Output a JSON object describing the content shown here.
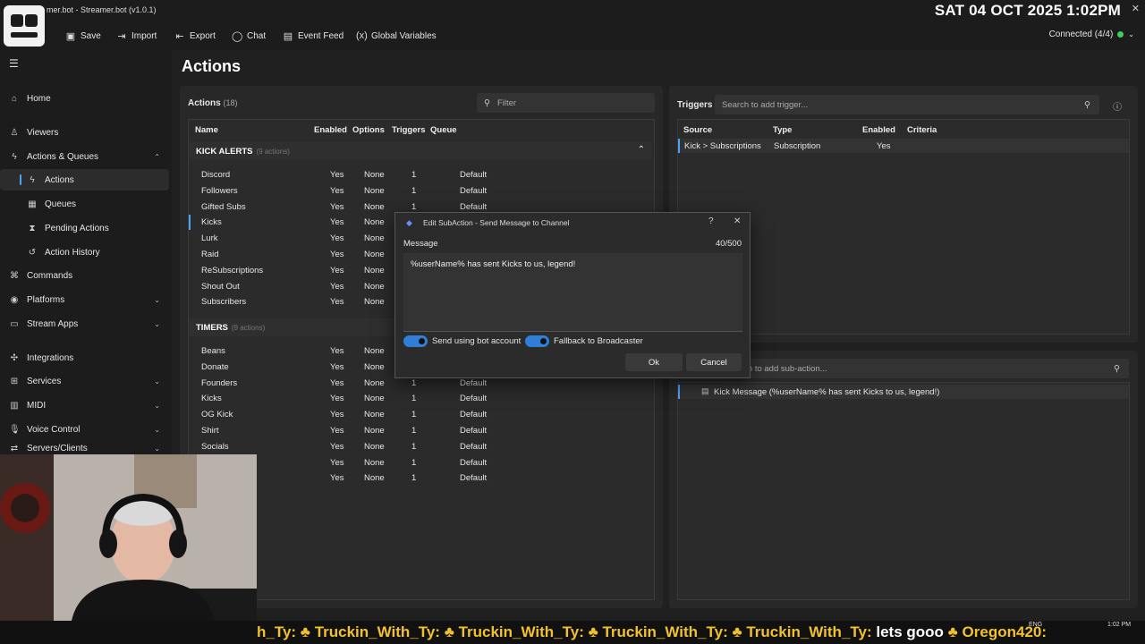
{
  "window": {
    "title": "mer.bot - Streamer.bot (v1.0.1)",
    "clock": "SAT 04 OCT 2025 1:02PM",
    "connected": "Connected (4/4)",
    "min_glyph": "—",
    "max_glyph": "☐",
    "close_glyph": "✕"
  },
  "toolbar": {
    "save": "Save",
    "import": "Import",
    "export": "Export",
    "chat": "Chat",
    "event_feed": "Event Feed",
    "global_variables": "Global Variables"
  },
  "sidebar": {
    "home": "Home",
    "viewers": "Viewers",
    "actions_queues": "Actions & Queues",
    "actions": "Actions",
    "queues": "Queues",
    "pending_actions": "Pending Actions",
    "action_history": "Action History",
    "commands": "Commands",
    "platforms": "Platforms",
    "stream_apps": "Stream Apps",
    "integrations": "Integrations",
    "services": "Services",
    "midi": "MIDI",
    "voice_control": "Voice Control",
    "servers_clients": "Servers/Clients"
  },
  "main": {
    "page_title": "Actions",
    "actions_label": "Actions",
    "actions_count": "(18)",
    "filter_placeholder": "Filter",
    "columns": [
      "Name",
      "Enabled",
      "Options",
      "Triggers",
      "Queue"
    ],
    "group1": {
      "name": "KICK ALERTS",
      "count": "(9 actions)"
    },
    "group1_rows": [
      {
        "name": "Discord",
        "enabled": "Yes",
        "options": "None",
        "triggers": "1",
        "queue": "Default"
      },
      {
        "name": "Followers",
        "enabled": "Yes",
        "options": "None",
        "triggers": "1",
        "queue": "Default"
      },
      {
        "name": "Gifted Subs",
        "enabled": "Yes",
        "options": "None",
        "triggers": "1",
        "queue": "Default"
      },
      {
        "name": "Kicks",
        "enabled": "Yes",
        "options": "None",
        "triggers": "",
        "queue": ""
      },
      {
        "name": "Lurk",
        "enabled": "Yes",
        "options": "None",
        "triggers": "",
        "queue": ""
      },
      {
        "name": "Raid",
        "enabled": "Yes",
        "options": "None",
        "triggers": "",
        "queue": ""
      },
      {
        "name": "ReSubscriptions",
        "enabled": "Yes",
        "options": "None",
        "triggers": "",
        "queue": ""
      },
      {
        "name": "Shout Out",
        "enabled": "Yes",
        "options": "None",
        "triggers": "",
        "queue": ""
      },
      {
        "name": "Subscribers",
        "enabled": "Yes",
        "options": "None",
        "triggers": "",
        "queue": ""
      }
    ],
    "group2": {
      "name": "TIMERS",
      "count": "(9 actions)"
    },
    "group2_rows": [
      {
        "name": "Beans",
        "enabled": "Yes",
        "options": "None",
        "triggers": "",
        "queue": ""
      },
      {
        "name": "Donate",
        "enabled": "Yes",
        "options": "None",
        "triggers": "",
        "queue": ""
      },
      {
        "name": "Founders",
        "enabled": "Yes",
        "options": "None",
        "triggers": "1",
        "queue": "Default"
      },
      {
        "name": "Kicks",
        "enabled": "Yes",
        "options": "None",
        "triggers": "1",
        "queue": "Default"
      },
      {
        "name": "OG Kick",
        "enabled": "Yes",
        "options": "None",
        "triggers": "1",
        "queue": "Default"
      },
      {
        "name": "Shirt",
        "enabled": "Yes",
        "options": "None",
        "triggers": "1",
        "queue": "Default"
      },
      {
        "name": "Socials",
        "enabled": "Yes",
        "options": "None",
        "triggers": "1",
        "queue": "Default"
      },
      {
        "name": "",
        "enabled": "Yes",
        "options": "None",
        "triggers": "1",
        "queue": "Default"
      },
      {
        "name": "",
        "enabled": "Yes",
        "options": "None",
        "triggers": "1",
        "queue": "Default"
      }
    ]
  },
  "triggers": {
    "label": "Triggers",
    "search_placeholder": "Search to add trigger...",
    "columns": [
      "Source",
      "Type",
      "Enabled",
      "Criteria"
    ],
    "row": {
      "source": "Kick > Subscriptions",
      "type": "Subscription",
      "enabled": "Yes",
      "criteria": ""
    }
  },
  "subactions": {
    "search_placeholder": "rch to add sub-action...",
    "item": "Kick Message (%userName% has sent Kicks to us, legend!)"
  },
  "dialog": {
    "title": "Edit SubAction - Send Message to Channel",
    "help": "?",
    "close": "✕",
    "message_label": "Message",
    "char_count": "40/500",
    "message": "%userName% has sent Kicks to us, legend!",
    "toggle_bot": "Send using bot account",
    "toggle_fallback": "Fallback to Broadcaster",
    "ok": "Ok",
    "cancel": "Cancel"
  },
  "ticker": {
    "text_parts": [
      "h_Ty:",
      "Truckin_With_Ty:",
      "Truckin_With_Ty:",
      "Truckin_With_Ty:",
      "Truckin_With_Ty:"
    ],
    "msg": "lets gooo",
    "user_last": "Oregon420:"
  },
  "taskbar": {
    "lang": "ENG",
    "time": "1:02 PM"
  }
}
